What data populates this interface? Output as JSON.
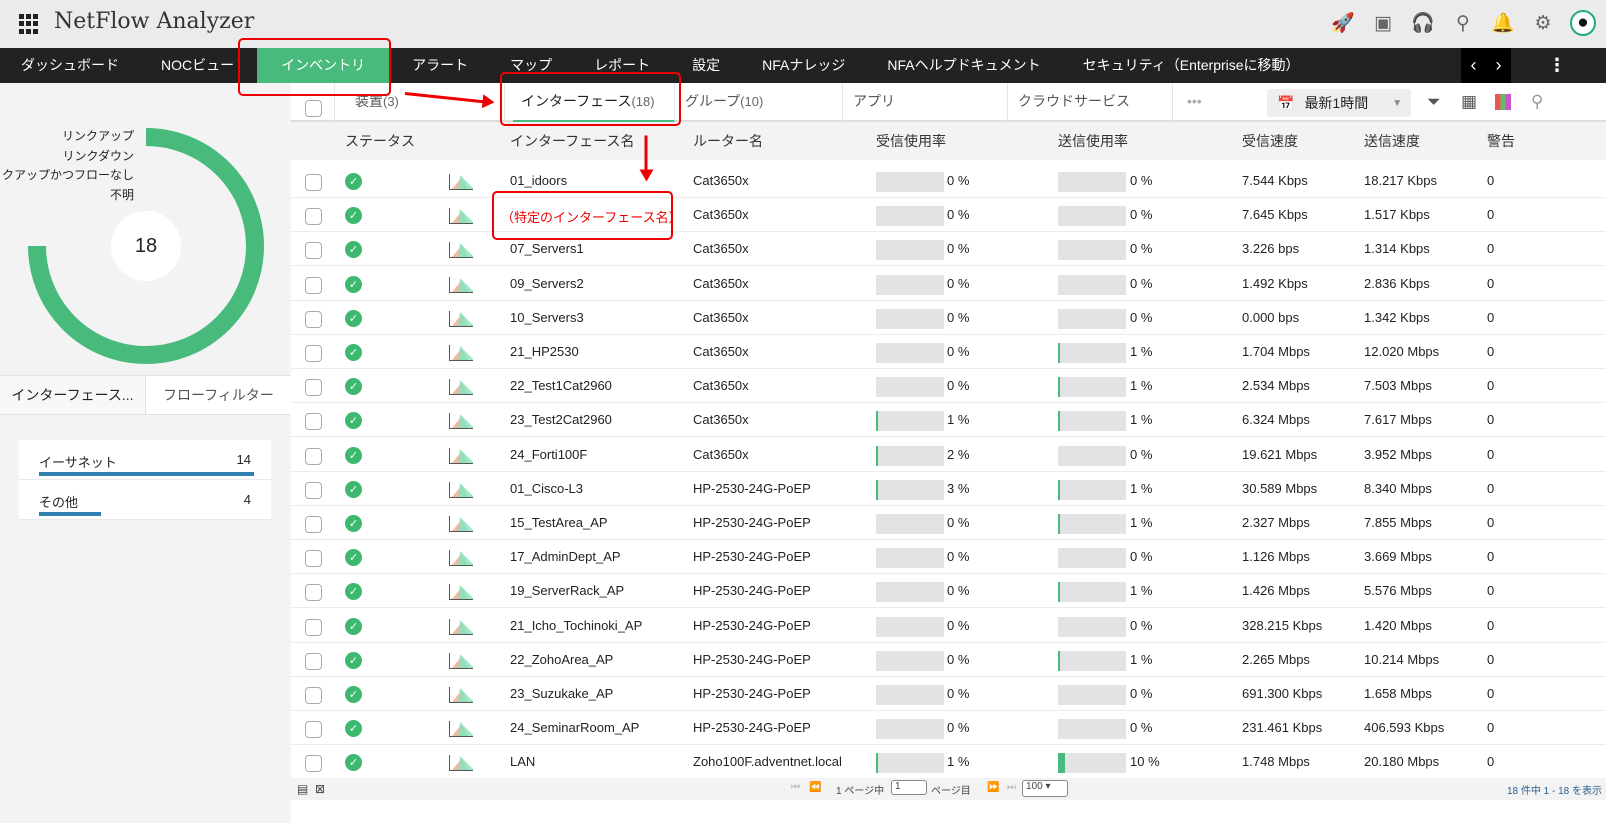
{
  "app": {
    "title": "NetFlow Analyzer"
  },
  "topbar": {
    "icons": [
      "rocket-icon",
      "presentation-icon",
      "headset-icon",
      "search-icon",
      "bell-icon",
      "gear-icon",
      "avatar"
    ]
  },
  "nav": {
    "items": [
      "ダッシュボード",
      "NOCビュー",
      "インベントリ",
      "アラート",
      "マップ",
      "レポート",
      "設定",
      "NFAナレッジ",
      "NFAヘルプドキュメント",
      "セキュリティ（Enterpriseに移動）"
    ],
    "active": 2
  },
  "left": {
    "legend": [
      "リンクアップ",
      "リンクダウン",
      "クアップかつフローなし",
      "不明"
    ],
    "total": "18",
    "tabs": [
      "インターフェース...",
      "フローフィルター"
    ],
    "categories": [
      {
        "name": "イーサネット",
        "count": "14",
        "fraction": 1.0
      },
      {
        "name": "その他",
        "count": "4",
        "fraction": 0.29
      }
    ]
  },
  "tabs": {
    "devices": "装置",
    "devices_count": "(3)",
    "interfaces": "インターフェース",
    "interfaces_count": "(18)",
    "groups": "グループ",
    "groups_count": "(10)",
    "apps": "アプリ",
    "cloud": "クラウドサービス",
    "more": "•••",
    "time_range": "最新1時間"
  },
  "columns": [
    "ステータス",
    "インターフェース名",
    "ルーター名",
    "受信使用率",
    "送信使用率",
    "受信速度",
    "送信速度",
    "警告"
  ],
  "rows": [
    [
      "01_idoors",
      "Cat3650x",
      0,
      0,
      "7.544 Kbps",
      "18.217 Kbps",
      "0"
    ],
    [
      "（特定のインターフェース名）",
      "Cat3650x",
      0,
      0,
      "7.645 Kbps",
      "1.517 Kbps",
      "0"
    ],
    [
      "07_Servers1",
      "Cat3650x",
      0,
      0,
      "3.226 bps",
      "1.314 Kbps",
      "0"
    ],
    [
      "09_Servers2",
      "Cat3650x",
      0,
      0,
      "1.492 Kbps",
      "2.836 Kbps",
      "0"
    ],
    [
      "10_Servers3",
      "Cat3650x",
      0,
      0,
      "0.000 bps",
      "1.342 Kbps",
      "0"
    ],
    [
      "21_HP2530",
      "Cat3650x",
      0,
      1,
      "1.704 Mbps",
      "12.020 Mbps",
      "0"
    ],
    [
      "22_Test1Cat2960",
      "Cat3650x",
      0,
      1,
      "2.534 Mbps",
      "7.503 Mbps",
      "0"
    ],
    [
      "23_Test2Cat2960",
      "Cat3650x",
      1,
      1,
      "6.324 Mbps",
      "7.617 Mbps",
      "0"
    ],
    [
      "24_Forti100F",
      "Cat3650x",
      2,
      0,
      "19.621 Mbps",
      "3.952 Mbps",
      "0"
    ],
    [
      "01_Cisco-L3",
      "HP-2530-24G-PoEP",
      3,
      1,
      "30.589 Mbps",
      "8.340 Mbps",
      "0"
    ],
    [
      "15_TestArea_AP",
      "HP-2530-24G-PoEP",
      0,
      1,
      "2.327 Mbps",
      "7.855 Mbps",
      "0"
    ],
    [
      "17_AdminDept_AP",
      "HP-2530-24G-PoEP",
      0,
      0,
      "1.126 Mbps",
      "3.669 Mbps",
      "0"
    ],
    [
      "19_ServerRack_AP",
      "HP-2530-24G-PoEP",
      0,
      1,
      "1.426 Mbps",
      "5.576 Mbps",
      "0"
    ],
    [
      "21_Icho_Tochinoki_AP",
      "HP-2530-24G-PoEP",
      0,
      0,
      "328.215 Kbps",
      "1.420 Mbps",
      "0"
    ],
    [
      "22_ZohoArea_AP",
      "HP-2530-24G-PoEP",
      0,
      1,
      "2.265 Mbps",
      "10.214 Mbps",
      "0"
    ],
    [
      "23_Suzukake_AP",
      "HP-2530-24G-PoEP",
      0,
      0,
      "691.300 Kbps",
      "1.658 Mbps",
      "0"
    ],
    [
      "24_SeminarRoom_AP",
      "HP-2530-24G-PoEP",
      0,
      0,
      "231.461 Kbps",
      "406.593 Kbps",
      "0"
    ],
    [
      "LAN",
      "Zoho100F.adventnet.local",
      1,
      10,
      "1.748 Mbps",
      "20.180 Mbps",
      "0"
    ]
  ],
  "footer": {
    "page_prefix": "1 ページ中",
    "page_value": "1",
    "page_suffix": "ページ目",
    "per_page": "100",
    "summary": "18 件中 1 - 18 を表示"
  },
  "colors": {
    "accent": "#48bb7c",
    "nav": "#222222",
    "annotation": "#ee0000"
  }
}
